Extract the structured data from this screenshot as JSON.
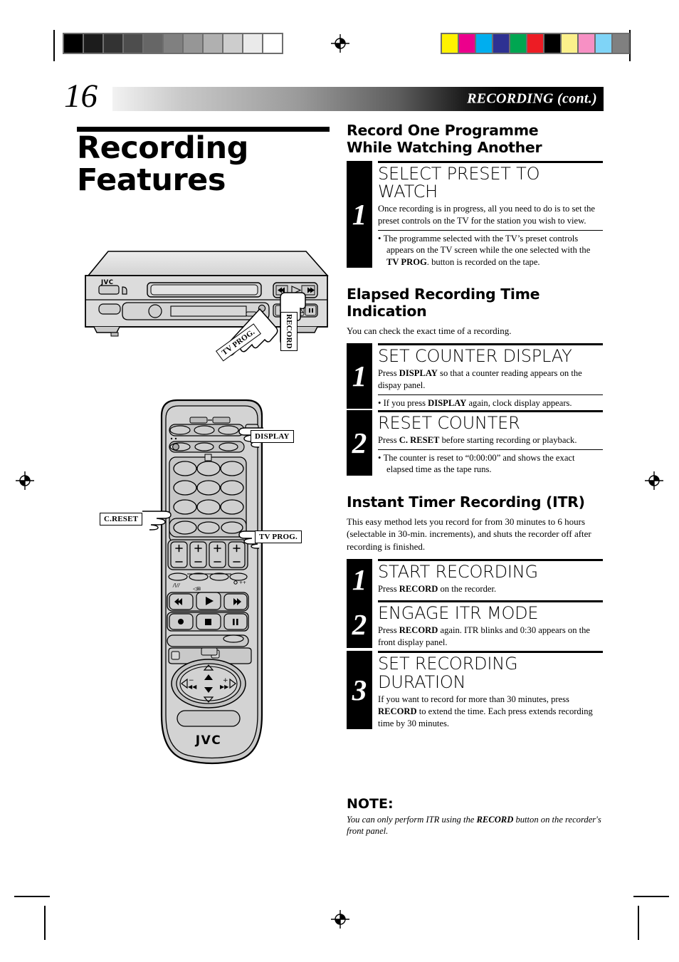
{
  "page": {
    "number": "16",
    "header_band_label": "RECORDING (cont.)",
    "main_title_line1": "Recording",
    "main_title_line2": "Features"
  },
  "sections": [
    {
      "id": "record-one-programme",
      "heading_line1": "Record One Programme",
      "heading_line2": "While Watching Another",
      "intro": "",
      "steps": [
        {
          "number": "1",
          "title": "SELECT PRESET TO WATCH",
          "desc": "Once recording is in progress, all you need to do is to set the preset controls on the TV for the station you wish to view.",
          "bullets": [
            "The programme selected with the TV’s preset controls appears on the TV screen while the one selected with the TV PROG. button is recorded on the tape."
          ],
          "bullet_bold": "TV PROG"
        }
      ]
    },
    {
      "id": "elapsed-recording-time",
      "heading_line1": "Elapsed Recording Time",
      "heading_line2": "Indication",
      "intro": "You can check the exact time of a recording.",
      "steps": [
        {
          "number": "1",
          "title": "SET COUNTER DISPLAY",
          "desc_pre": "Press ",
          "desc_bold": "DISPLAY",
          "desc_post": " so that a counter reading appears on the dispay panel.",
          "bullet_pre": "If you press ",
          "bullet_bold": "DISPLAY",
          "bullet_post": " again, clock display appears."
        },
        {
          "number": "2",
          "title": "RESET COUNTER",
          "desc_pre": "Press ",
          "desc_bold": "C. RESET",
          "desc_post": " before starting recording or playback.",
          "bullet_pre": "The counter is reset to “0:00:00” and shows the exact elapsed time as the tape runs.",
          "bullet_bold": "",
          "bullet_post": ""
        }
      ]
    },
    {
      "id": "instant-timer-recording",
      "heading_line1": "Instant Timer Recording (ITR)",
      "heading_line2": "",
      "intro": "This easy method lets you record for from 30 minutes to 6 hours (selectable in 30-min. increments), and shuts the recorder off after recording is finished.",
      "steps": [
        {
          "number": "1",
          "title": "START RECORDING",
          "desc_pre": "Press ",
          "desc_bold": "RECORD",
          "desc_post": " on the recorder."
        },
        {
          "number": "2",
          "title": "ENGAGE ITR MODE",
          "desc_pre": "Press ",
          "desc_bold": "RECORD",
          "desc_post": " again. ITR blinks and 0:30 appears on the front display panel."
        },
        {
          "number": "3",
          "title": "SET RECORDING DURATION",
          "title_line1": "SET RECORDING",
          "title_line2": "DURATION",
          "desc_pre": "If you want to record for more than 30 minutes, press ",
          "desc_bold": "RECORD",
          "desc_post": " to extend the time. Each press extends recording time by 30 minutes."
        }
      ]
    }
  ],
  "note": {
    "heading": "NOTE:",
    "text_pre": "You can only perform ITR using the ",
    "text_bold": "RECORD",
    "text_post": " button on the recorder's front panel."
  },
  "illustrations": {
    "vcr": {
      "brand": "JVC",
      "callouts": [
        {
          "id": "tv-prog-front",
          "label": "TV PROG."
        },
        {
          "id": "record-front",
          "label": "RECORD"
        }
      ]
    },
    "remote": {
      "brand": "JVC",
      "callouts": [
        {
          "id": "display",
          "label": "DISPLAY"
        },
        {
          "id": "c-reset",
          "label": "C.RESET"
        },
        {
          "id": "tv-prog-remote",
          "label": "TV PROG."
        }
      ]
    }
  },
  "print_marks": {
    "grayscale_steps": [
      "#000000",
      "#1c1c1c",
      "#333333",
      "#4d4d4d",
      "#666666",
      "#808080",
      "#969696",
      "#b0b0b0",
      "#cdcdcd",
      "#eaeaea",
      "#ffffff"
    ],
    "color_patches": [
      "#fff200",
      "#ec008c",
      "#00aeef",
      "#2e3192",
      "#00a651",
      "#ed1c24",
      "#000000",
      "#fbf08b",
      "#f790c4",
      "#7fd4f7",
      "#808080"
    ]
  }
}
